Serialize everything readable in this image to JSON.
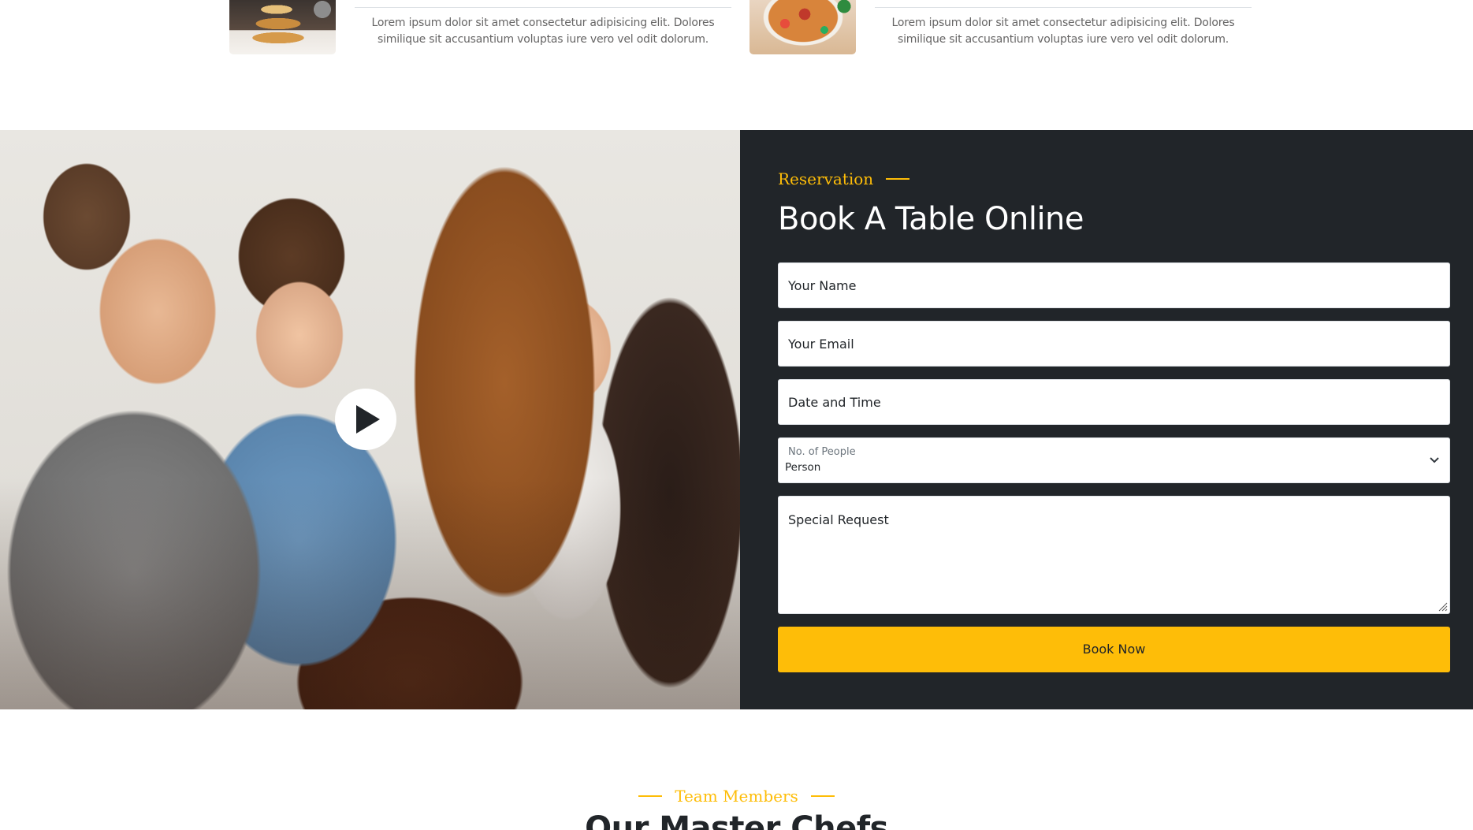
{
  "menu": {
    "items": [
      {
        "image": "pancakes-thumbnail",
        "description": "Lorem ipsum dolor sit amet consectetur adipisicing elit. Dolores similique sit accusantium voluptas iure vero vel odit dolorum."
      },
      {
        "image": "noodle-soup-thumbnail",
        "description": "Lorem ipsum dolor sit amet consectetur adipisicing elit. Dolores similique sit accusantium voluptas iure vero vel odit dolorum."
      }
    ]
  },
  "reservation": {
    "video_icon": "play-icon",
    "eyebrow": "Reservation",
    "title": "Book A Table Online",
    "fields": {
      "name": "Your Name",
      "email": "Your Email",
      "datetime": "Date and Time",
      "people_label": "No. of People",
      "people_value": "Person",
      "special_request": "Special Request"
    },
    "submit_label": "Book Now"
  },
  "team": {
    "eyebrow": "Team Members",
    "title": "Our Master Chefs"
  },
  "colors": {
    "accent": "#FEBD08",
    "dark": "#212529",
    "body_text": "#666565"
  }
}
